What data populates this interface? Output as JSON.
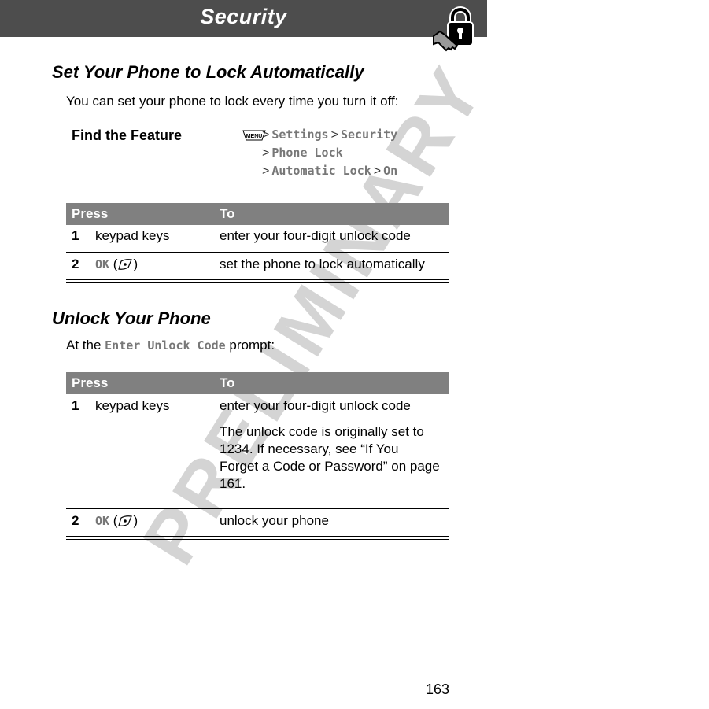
{
  "header": {
    "title": "Security",
    "icon": "lock-and-key-icon"
  },
  "watermark": "PRELIMINARY",
  "section1": {
    "heading": "Set Your Phone to Lock Automatically",
    "intro": "You can set your phone to lock every time you turn it off:",
    "find_feature": {
      "label": "Find the Feature",
      "menu_icon": "menu-key-icon",
      "menu_label": "MENU",
      "path_lines": [
        [
          "Settings",
          "Security"
        ],
        [
          "Phone Lock"
        ],
        [
          "Automatic Lock",
          "On"
        ]
      ]
    },
    "table": {
      "headers": [
        "Press",
        "To"
      ],
      "rows": [
        {
          "num": "1",
          "press": "keypad keys",
          "to": "enter your four-digit unlock code"
        },
        {
          "num": "2",
          "press_key": "OK",
          "press_icon": "right-soft-key-icon",
          "to": "set the phone to lock automatically"
        }
      ]
    }
  },
  "section2": {
    "heading": "Unlock Your Phone",
    "intro_prefix": "At the",
    "intro_code": "Enter Unlock Code",
    "intro_suffix": "prompt:",
    "table": {
      "headers": [
        "Press",
        "To"
      ],
      "rows": [
        {
          "num": "1",
          "press": "keypad keys",
          "to": "enter your four-digit unlock code",
          "note": "The unlock code is originally set to 1234. If necessary, see “If You Forget a Code or Password” on page 161."
        },
        {
          "num": "2",
          "press_key": "OK",
          "press_icon": "right-soft-key-icon",
          "to": "unlock your phone"
        }
      ]
    }
  },
  "footer": {
    "page_number": "163"
  }
}
